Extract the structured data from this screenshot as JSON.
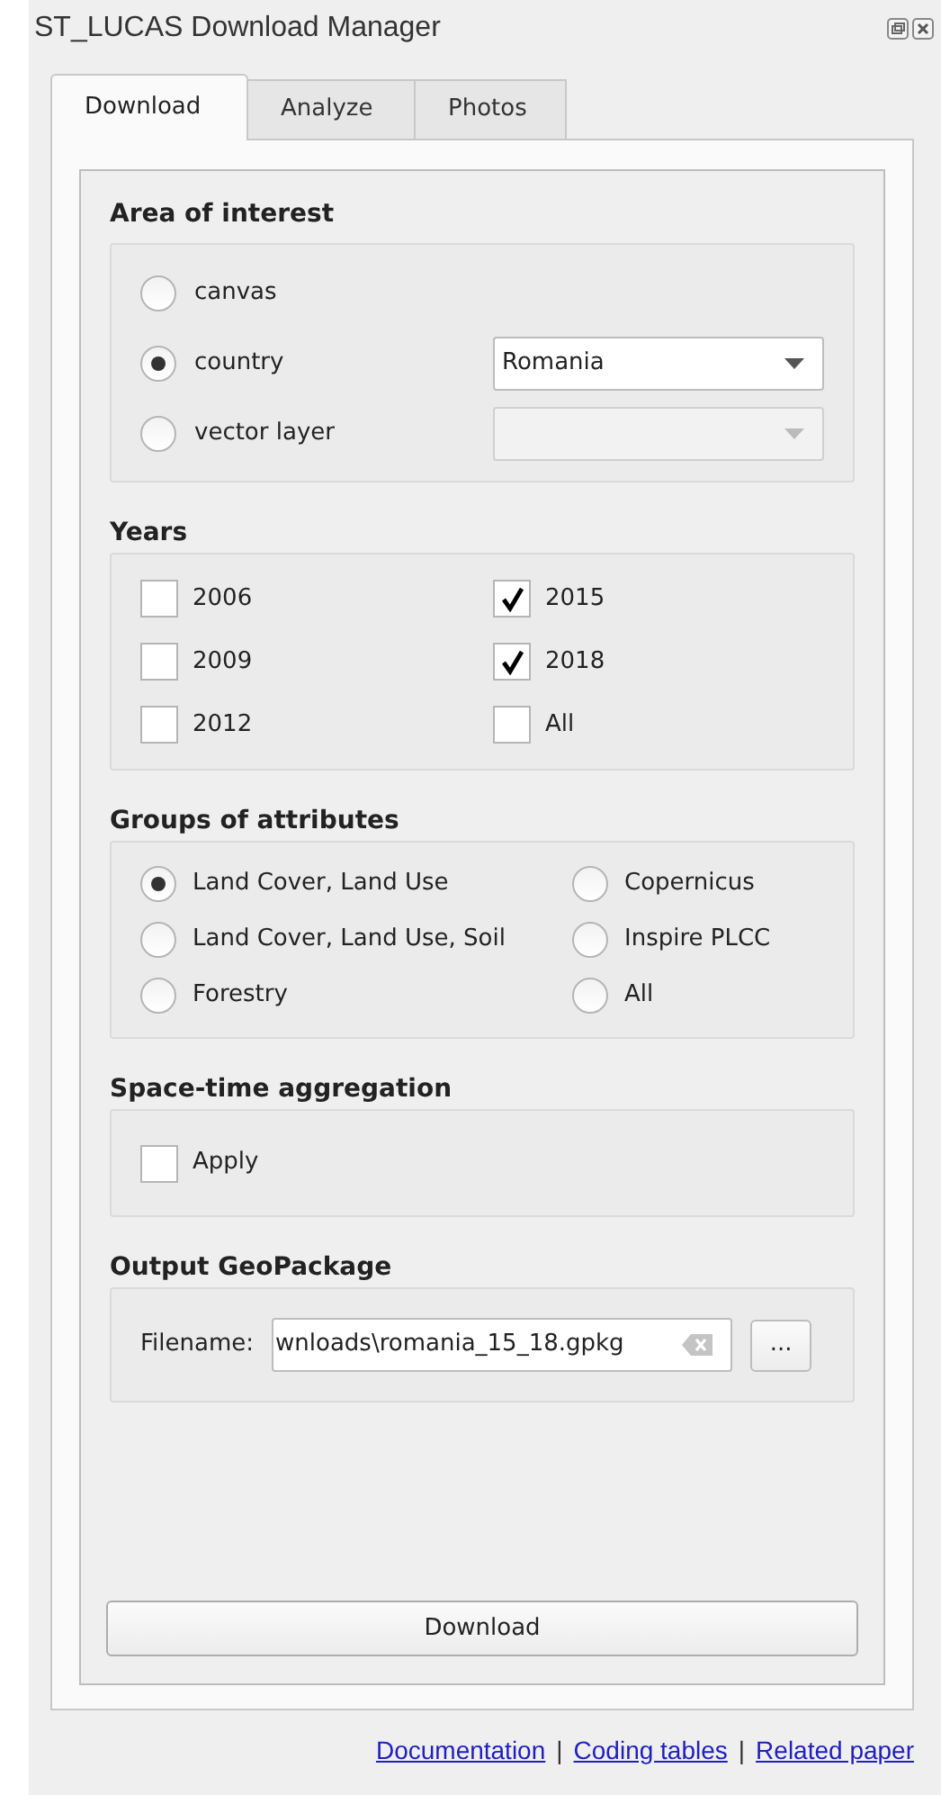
{
  "window": {
    "title": "ST_LUCAS Download Manager"
  },
  "tabs": [
    {
      "label": "Download",
      "selected": true
    },
    {
      "label": "Analyze",
      "selected": false
    },
    {
      "label": "Photos",
      "selected": false
    }
  ],
  "area_of_interest": {
    "title": "Area of interest",
    "options": [
      {
        "label": "canvas",
        "selected": false
      },
      {
        "label": "country",
        "selected": true,
        "dropdown": {
          "value": "Romania",
          "disabled": false
        }
      },
      {
        "label": "vector layer",
        "selected": false,
        "dropdown": {
          "disabled": true
        }
      }
    ]
  },
  "years": {
    "title": "Years",
    "items": [
      {
        "label": "2006",
        "checked": false
      },
      {
        "label": "2015",
        "checked": true
      },
      {
        "label": "2009",
        "checked": false
      },
      {
        "label": "2018",
        "checked": true
      },
      {
        "label": "2012",
        "checked": false
      },
      {
        "label": "All",
        "checked": false
      }
    ]
  },
  "groups_of_attributes": {
    "title": "Groups of attributes",
    "options": [
      {
        "label": "Land Cover, Land Use",
        "selected": true
      },
      {
        "label": "Copernicus",
        "selected": false
      },
      {
        "label": "Land Cover, Land Use, Soil",
        "selected": false
      },
      {
        "label": "Inspire PLCC",
        "selected": false
      },
      {
        "label": "Forestry",
        "selected": false
      },
      {
        "label": "All",
        "selected": false
      }
    ]
  },
  "space_time_aggregation": {
    "title": "Space-time aggregation",
    "apply": {
      "label": "Apply",
      "checked": false
    }
  },
  "output": {
    "title": "Output GeoPackage",
    "label": "Filename:",
    "value": "wnloads\\romania_15_18.gpkg",
    "browse": "..."
  },
  "download_button": "Download",
  "footer": [
    {
      "kind": "link",
      "label": "Documentation"
    },
    {
      "kind": "separator",
      "label": "|"
    },
    {
      "kind": "link",
      "label": "Coding tables"
    },
    {
      "kind": "separator",
      "label": "|"
    },
    {
      "kind": "link",
      "label": "Related paper"
    }
  ]
}
